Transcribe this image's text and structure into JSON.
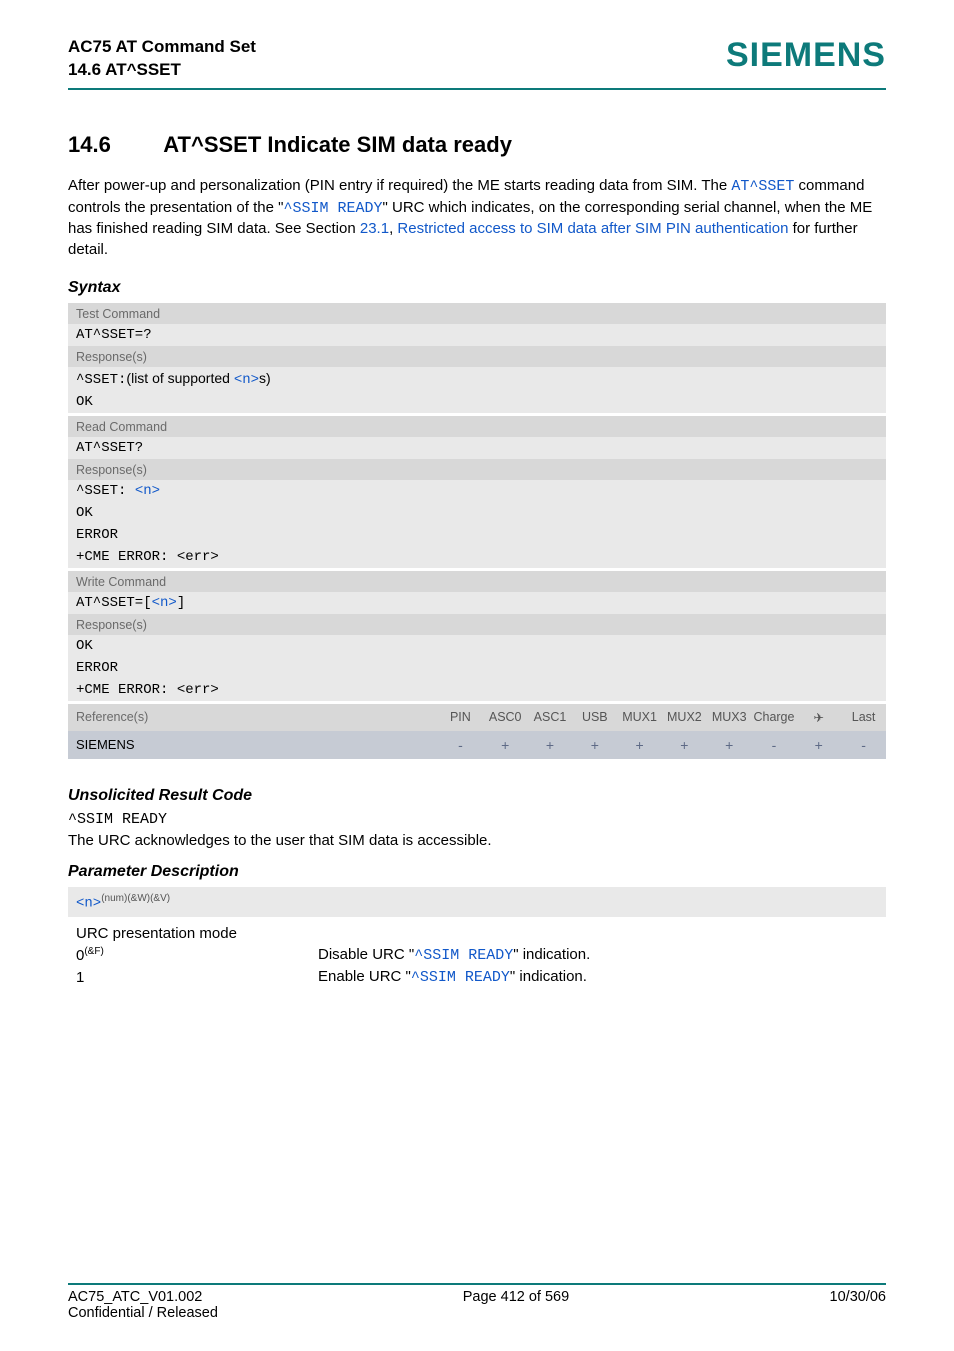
{
  "header": {
    "title_line1": "AC75 AT Command Set",
    "title_line2": "14.6 AT^SSET",
    "brand": "SIEMENS"
  },
  "section": {
    "number": "14.6",
    "title": "AT^SSET   Indicate SIM data ready"
  },
  "intro": {
    "p1": "After power-up and personalization (PIN entry if required) the ME starts reading data from SIM. The ",
    "p1_link1": "AT^SSET",
    "p2": " command controls the presentation of the \"",
    "p2_link1": "^SSIM READY",
    "p3": "\" URC which indicates, on the corresponding serial channel, when the ME has finished reading SIM data. See Section ",
    "p3_link1": "23.1",
    "p3_mid": ", ",
    "p3_link2": "Restricted access to SIM data after SIM PIN authentication",
    "p4": " for further detail."
  },
  "syntax_heading": "Syntax",
  "blocks": {
    "test": {
      "label": "Test Command",
      "cmd": "AT^SSET=?",
      "resp_label": "Response(s)",
      "resp1_a": "^SSET:",
      "resp1_b": "(list of supported ",
      "resp1_n": "<n>",
      "resp1_c": "s)",
      "resp2": "OK"
    },
    "read": {
      "label": "Read Command",
      "cmd": "AT^SSET?",
      "resp_label": "Response(s)",
      "r1a": "^SSET: ",
      "r1n": "<n>",
      "r2": "OK",
      "r3": "ERROR",
      "r4": "+CME ERROR: <err>"
    },
    "write": {
      "label": "Write Command",
      "cmd_a": "AT^SSET=[",
      "cmd_n": "<n>",
      "cmd_b": "]",
      "resp_label": "Response(s)",
      "r1": "OK",
      "r2": "ERROR",
      "r3": "+CME ERROR: <err>"
    }
  },
  "ref": {
    "label": "Reference(s)",
    "cols": [
      "PIN",
      "ASC0",
      "ASC1",
      "USB",
      "MUX1",
      "MUX2",
      "MUX3",
      "Charge",
      "✈",
      "Last"
    ],
    "row_label": "SIEMENS",
    "row_vals": [
      "-",
      "+",
      "+",
      "+",
      "+",
      "+",
      "+",
      "-",
      "+",
      "-"
    ]
  },
  "urc": {
    "heading": "Unsolicited Result Code",
    "code": "^SSIM READY",
    "desc": "The URC acknowledges to the user that SIM data is accessible."
  },
  "param": {
    "heading": "Parameter Description",
    "bar_n": "<n>",
    "bar_sup": "(num)(&W)(&V)",
    "body": "URC presentation mode",
    "rows": [
      {
        "k": "0",
        "ks": "(&F)",
        "v_a": "Disable URC \"",
        "v_m": "^SSIM READY",
        "v_b": "\" indication."
      },
      {
        "k": "1",
        "ks": "",
        "v_a": "Enable URC \"",
        "v_m": "^SSIM READY",
        "v_b": "\" indication."
      }
    ]
  },
  "footer": {
    "left": "AC75_ATC_V01.002",
    "center": "Page 412 of 569",
    "right": "10/30/06",
    "left2": "Confidential / Released"
  }
}
